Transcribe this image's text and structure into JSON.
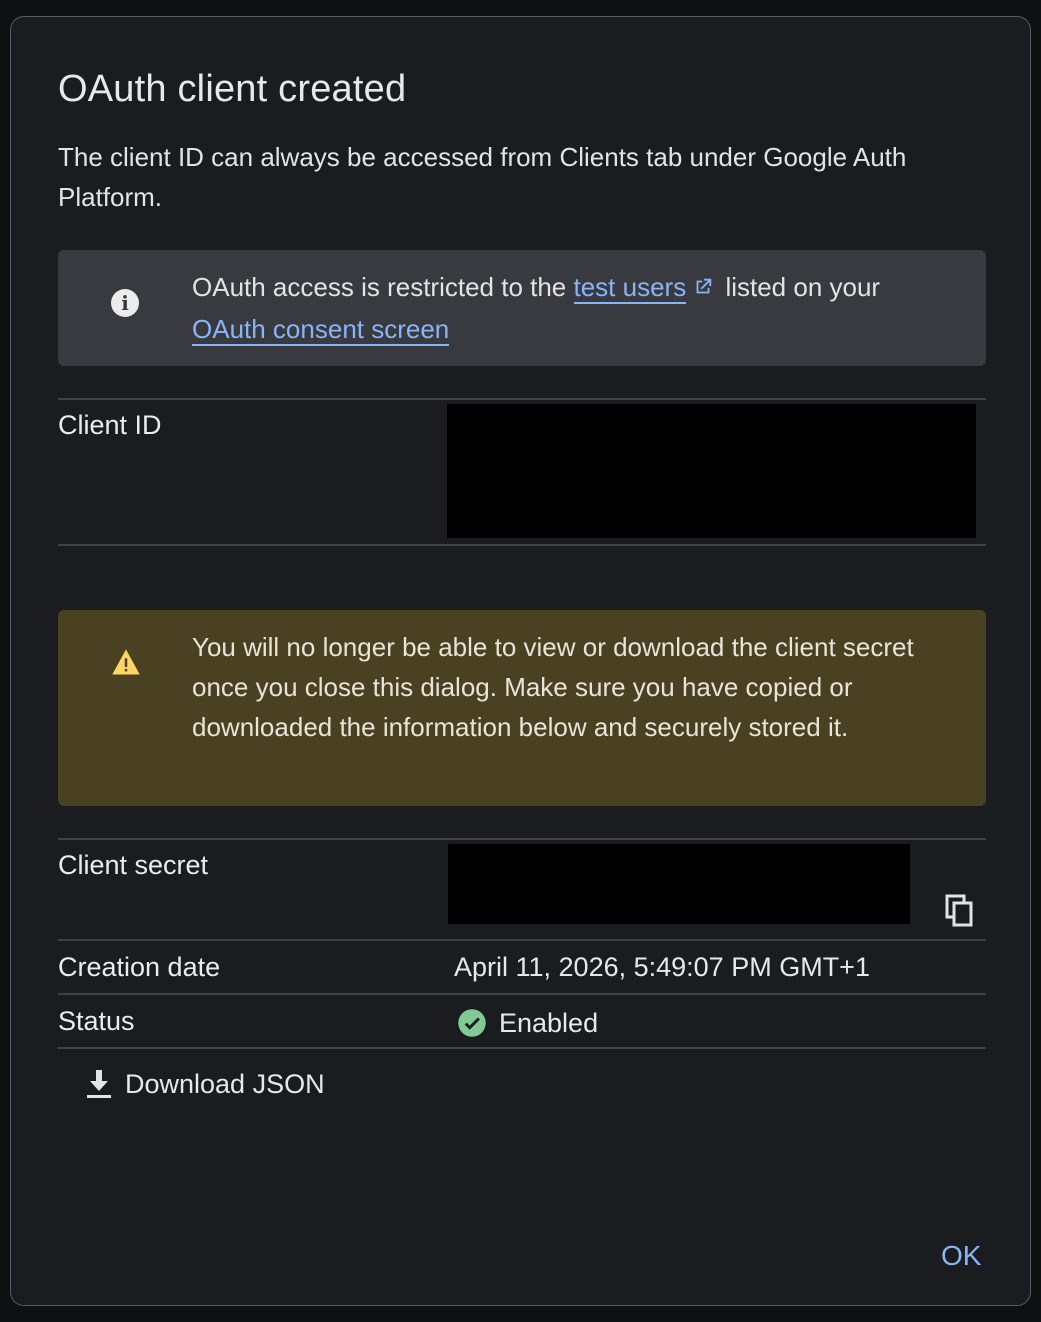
{
  "dialog": {
    "title": "OAuth client created",
    "subtitle": "The client ID can always be accessed from Clients tab under Google Auth Platform."
  },
  "info_banner": {
    "icon": "info-icon",
    "text_before": "OAuth access is restricted to the ",
    "link_test_users": "test users",
    "text_middle": " listed on your ",
    "link_consent": "OAuth consent screen"
  },
  "client_id": {
    "label": "Client ID"
  },
  "warning_banner": {
    "icon": "warning-icon",
    "text": "You will no longer be able to view or download the client secret once you close this dialog. Make sure you have copied or downloaded the information below and securely stored it."
  },
  "client_secret": {
    "label": "Client secret",
    "copy_icon": "copy-icon"
  },
  "creation_date": {
    "label": "Creation date",
    "value": "April 11, 2026, 5:49:07 PM GMT+1"
  },
  "status": {
    "label": "Status",
    "value": "Enabled",
    "icon": "check-circle-icon",
    "color": "#81c995"
  },
  "actions": {
    "download_label": "Download JSON",
    "ok_label": "OK"
  },
  "colors": {
    "accent": "#8ab4f8",
    "info_bg": "#393a40",
    "warning_bg": "#4a4122",
    "warning_icon": "#fdd663"
  }
}
